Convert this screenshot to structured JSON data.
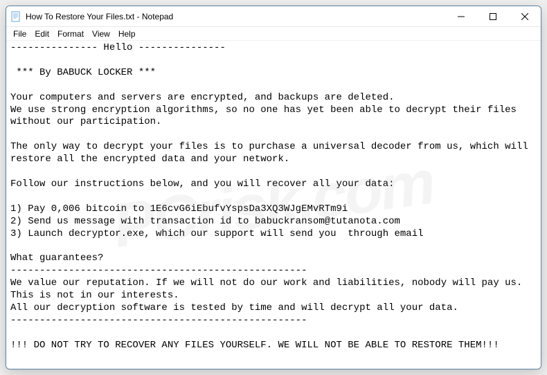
{
  "titlebar": {
    "title": "How To Restore Your Files.txt - Notepad"
  },
  "menubar": {
    "items": [
      "File",
      "Edit",
      "Format",
      "View",
      "Help"
    ]
  },
  "document": {
    "text": "--------------- Hello ---------------\n\n *** By BABUCK LOCKER ***\n\nYour computers and servers are encrypted, and backups are deleted.\nWe use strong encryption algorithms, so no one has yet been able to decrypt their files without our participation.\n\nThe only way to decrypt your files is to purchase a universal decoder from us, which will restore all the encrypted data and your network.\n\nFollow our instructions below, and you will recover all your data:\n\n1) Pay 0,006 bitcoin to 1E6cvG6iEbufvYspsDa3XQ3WJgEMvRTm9i\n2) Send us message with transaction id to babuckransom@tutanota.com\n3) Launch decryptor.exe, which our support will send you  through email\n\nWhat guarantees?\n---------------------------------------------------\nWe value our reputation. If we will not do our work and liabilities, nobody will pay us. This is not in our interests.\nAll our decryption software is tested by time and will decrypt all your data.\n---------------------------------------------------\n\n!!! DO NOT TRY TO RECOVER ANY FILES YOURSELF. WE WILL NOT BE ABLE TO RESTORE THEM!!!"
  },
  "watermark": {
    "text": "PCrisk.com"
  }
}
